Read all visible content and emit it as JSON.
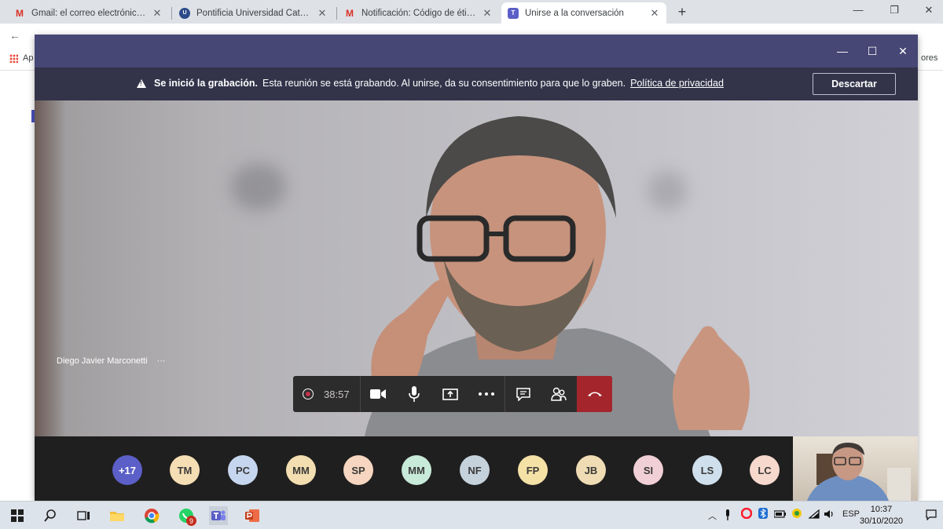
{
  "browser": {
    "tabs": [
      {
        "title": "Gmail: el correo electrónico de G",
        "icon": "gmail-icon"
      },
      {
        "title": "Pontificia Universidad Católica Ar",
        "icon": "uca-icon"
      },
      {
        "title": "Notificación: Código de ética en",
        "icon": "gmail-icon"
      },
      {
        "title": "Unirse a la conversación",
        "icon": "teams-icon"
      }
    ],
    "new_tab": "+",
    "bookmarks_apps": "Ap",
    "bookmarks_right": "ores"
  },
  "teams": {
    "banner": {
      "bold": "Se inició la grabación.",
      "text": "Esta reunión se está grabando. Al unirse, da su consentimiento para que lo graben.",
      "link": "Política de privacidad",
      "dismiss": "Descartar"
    },
    "speaker": {
      "name": "Diego Javier Marconetti",
      "more": "···"
    },
    "call": {
      "timer": "38:57"
    },
    "participants": [
      {
        "initials": "+17",
        "color": "#5b5fc7"
      },
      {
        "initials": "TM",
        "color": "#f5deb3"
      },
      {
        "initials": "PC",
        "color": "#c7d6ef"
      },
      {
        "initials": "MM",
        "color": "#f2deb0"
      },
      {
        "initials": "SP",
        "color": "#f6d6c0"
      },
      {
        "initials": "MM",
        "color": "#c8ead9"
      },
      {
        "initials": "NF",
        "color": "#c5d2dc"
      },
      {
        "initials": "FP",
        "color": "#f3e1a6"
      },
      {
        "initials": "JB",
        "color": "#efdcb4"
      },
      {
        "initials": "SI",
        "color": "#f0d0d6"
      },
      {
        "initials": "LS",
        "color": "#cfe0ec"
      },
      {
        "initials": "LC",
        "color": "#f6d8cd"
      }
    ]
  },
  "taskbar": {
    "lang": "ESP",
    "time": "10:37",
    "date": "30/10/2020",
    "whatsapp_badge": "9"
  }
}
